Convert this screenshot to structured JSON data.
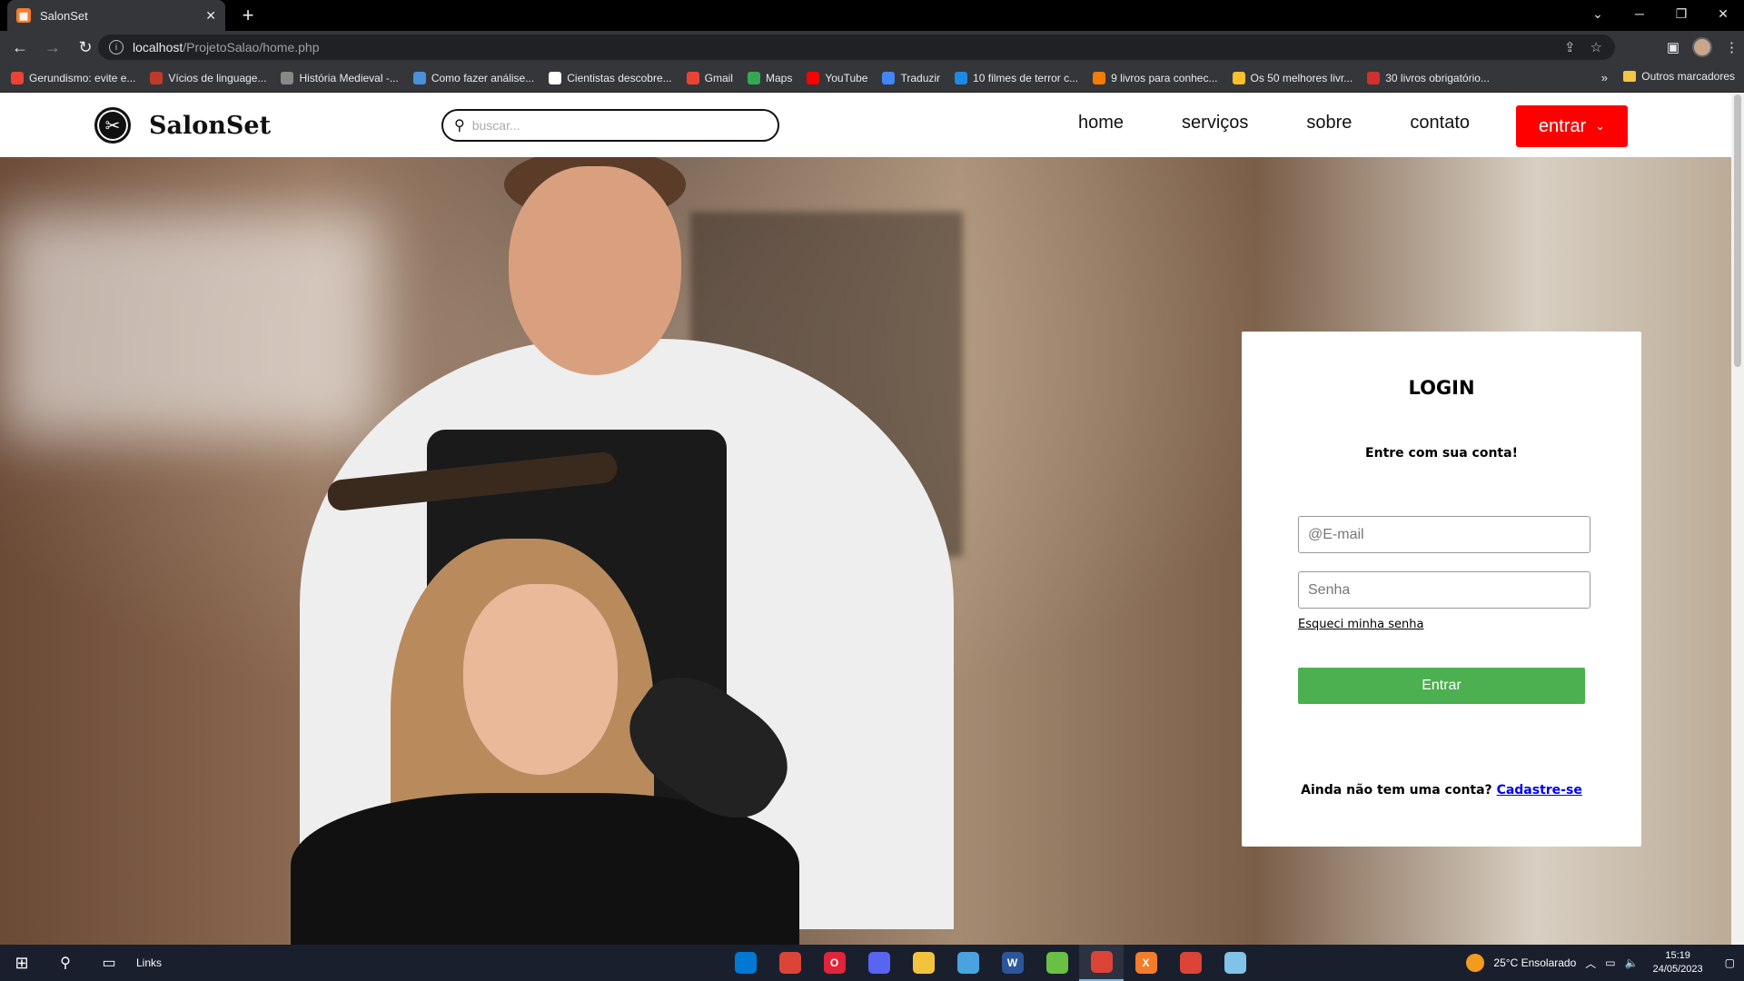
{
  "browser": {
    "tab_title": "SalonSet",
    "tab_favicon": "XAMPP",
    "url_host": "localhost",
    "url_path": "/ProjetoSalao/home.php",
    "bookmarks": [
      {
        "label": "Gerundismo: evite e...",
        "color": "#ea4335"
      },
      {
        "label": "Vícios de linguage...",
        "color": "#c0392b"
      },
      {
        "label": "História Medieval -...",
        "color": "#888888"
      },
      {
        "label": "Como fazer análise...",
        "color": "#4a90d9"
      },
      {
        "label": "Cientistas descobre...",
        "color": "#ffffff"
      },
      {
        "label": "Gmail",
        "color": "#ea4335"
      },
      {
        "label": "Maps",
        "color": "#34a853"
      },
      {
        "label": "YouTube",
        "color": "#ff0000"
      },
      {
        "label": "Traduzir",
        "color": "#4285f4"
      },
      {
        "label": "10 filmes de terror c...",
        "color": "#1e88e5"
      },
      {
        "label": "9 livros para conhec...",
        "color": "#f57c00"
      },
      {
        "label": "Os 50 melhores livr...",
        "color": "#fbc02d"
      },
      {
        "label": "30 livros obrigatório...",
        "color": "#d32f2f"
      }
    ],
    "bookmarks_more": "»",
    "other_bookmarks": "Outros marcadores"
  },
  "site": {
    "logo_text": "SalonSet",
    "search_placeholder": "buscar...",
    "nav": [
      "home",
      "serviços",
      "sobre",
      "contato"
    ],
    "enter_button": "entrar",
    "accent_color": "#ff0000"
  },
  "login": {
    "title": "LOGIN",
    "subtitle": "Entre com sua conta!",
    "email_placeholder": "@E-mail",
    "password_placeholder": "Senha",
    "forgot": "Esqueci minha senha",
    "submit": "Entrar",
    "signup_prompt": "Ainda não tem uma conta?",
    "signup_link": "Cadastre-se",
    "submit_color": "#4caf50"
  },
  "taskbar": {
    "links_label": "Links",
    "weather": "25°C  Ensolarado",
    "time": "15:19",
    "date": "24/05/2023",
    "apps": [
      {
        "name": "vscode-icon",
        "letter": "",
        "color": "#0078d4"
      },
      {
        "name": "chrome-icon",
        "letter": "",
        "color": "#db4437"
      },
      {
        "name": "opera-icon",
        "letter": "O",
        "color": "#e0243a"
      },
      {
        "name": "discord-icon",
        "letter": "",
        "color": "#5865f2"
      },
      {
        "name": "file-explorer-icon",
        "letter": "",
        "color": "#f3c33d"
      },
      {
        "name": "store-icon",
        "letter": "",
        "color": "#4aa3df"
      },
      {
        "name": "word-icon",
        "letter": "W",
        "color": "#2b579a"
      },
      {
        "name": "bluestacks-icon",
        "letter": "",
        "color": "#6abf45"
      },
      {
        "name": "chrome-profile-icon",
        "letter": "",
        "color": "#db4437"
      },
      {
        "name": "xampp-icon",
        "letter": "X",
        "color": "#f57c2b"
      },
      {
        "name": "chrome-profile2-icon",
        "letter": "",
        "color": "#db4437"
      },
      {
        "name": "notepad-icon",
        "letter": "",
        "color": "#7fc4e8"
      }
    ]
  }
}
